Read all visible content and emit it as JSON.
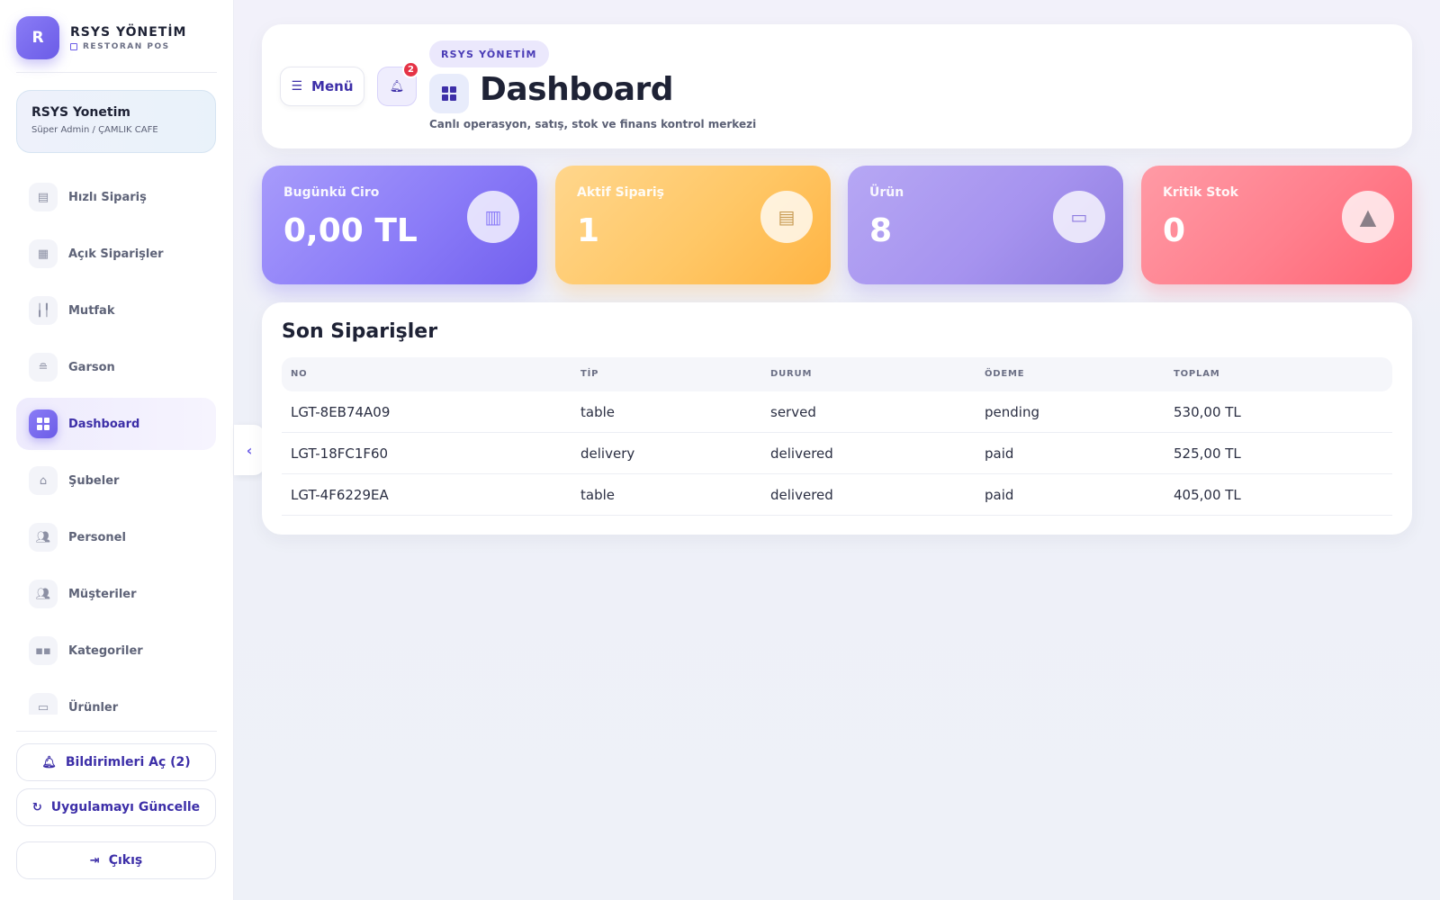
{
  "sidebar": {
    "brand": {
      "logo_letter": "R",
      "title": "RSYS YÖNETİM",
      "subtitle": "RESTORAN POS"
    },
    "user": {
      "name": "RSYS Yonetim",
      "role": "Süper Admin / ÇAMLIK CAFE"
    },
    "items": [
      {
        "label": "Hızlı Sipariş",
        "icon": "calculator-icon",
        "active": false
      },
      {
        "label": "Açık Siparişler",
        "icon": "receipt-icon",
        "active": false
      },
      {
        "label": "Mutfak",
        "icon": "utensils-icon",
        "active": false
      },
      {
        "label": "Garson",
        "icon": "room-service-icon",
        "active": false
      },
      {
        "label": "Dashboard",
        "icon": "dashboard-icon",
        "active": true
      },
      {
        "label": "Şubeler",
        "icon": "branch-icon",
        "active": false
      },
      {
        "label": "Personel",
        "icon": "people-icon",
        "active": false
      },
      {
        "label": "Müşteriler",
        "icon": "people-icon",
        "active": false
      },
      {
        "label": "Kategoriler",
        "icon": "category-icon",
        "active": false
      },
      {
        "label": "Ürünler",
        "icon": "box-icon",
        "active": false
      }
    ],
    "notifications_button": "Bildirimleri Aç (2)",
    "update_button": "Uygulamayı Güncelle",
    "logout_button": "Çıkış"
  },
  "header": {
    "menu_button": "Menü",
    "notification_count": "2",
    "breadcrumb": "RSYS YÖNETİM",
    "title": "Dashboard",
    "subtitle": "Canlı operasyon, satış, stok ve finans kontrol merkezi"
  },
  "stats": [
    {
      "label": "Bugünkü Ciro",
      "value": "0,00 TL",
      "icon": "store-icon"
    },
    {
      "label": "Aktif Sipariş",
      "value": "1",
      "icon": "receipt-icon"
    },
    {
      "label": "Ürün",
      "value": "8",
      "icon": "archive-box-icon"
    },
    {
      "label": "Kritik Stok",
      "value": "0",
      "icon": "warning-triangle-icon"
    }
  ],
  "colors": {
    "accent": "#6b5ce7",
    "card_revenue": "#8b7cf8",
    "card_active": "#ffc766",
    "card_product": "#a693ef",
    "card_critical": "#ff7f8d"
  },
  "orders": {
    "title": "Son Siparişler",
    "columns": [
      "NO",
      "TİP",
      "DURUM",
      "ÖDEME",
      "TOPLAM"
    ],
    "rows": [
      [
        "LGT-8EB74A09",
        "table",
        "served",
        "pending",
        "530,00 TL"
      ],
      [
        "LGT-18FC1F60",
        "delivery",
        "delivered",
        "paid",
        "525,00 TL"
      ],
      [
        "LGT-4F6229EA",
        "table",
        "delivered",
        "paid",
        "405,00 TL"
      ]
    ]
  }
}
